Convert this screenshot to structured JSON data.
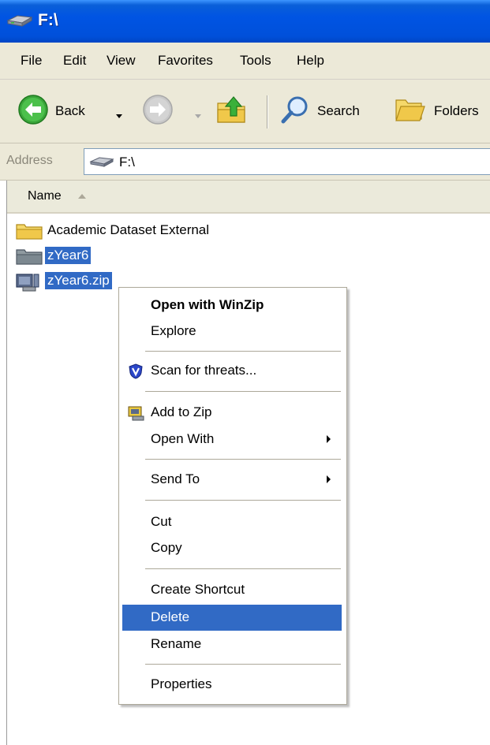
{
  "window": {
    "title": "F:\\"
  },
  "menu": [
    "File",
    "Edit",
    "View",
    "Favorites",
    "Tools",
    "Help"
  ],
  "toolbar": {
    "back_label": "Back",
    "search_label": "Search",
    "folders_label": "Folders"
  },
  "address": {
    "label": "Address",
    "value": "F:\\"
  },
  "columns": {
    "name": "Name"
  },
  "files": [
    {
      "name": "Academic Dataset External",
      "icon": "folder-icon",
      "selected": false
    },
    {
      "name": "zYear6",
      "icon": "folder-icon",
      "selected": true
    },
    {
      "name": "zYear6.zip",
      "icon": "zip-icon",
      "selected": true
    }
  ],
  "context_menu": {
    "items": [
      {
        "label": "Open with WinZip",
        "bold": true
      },
      {
        "label": "Explore"
      },
      {
        "label": "Scan for threats...",
        "icon": "shield-icon"
      },
      {
        "label": "Add to Zip",
        "icon": "winzip-icon"
      },
      {
        "label": "Open With",
        "submenu": true
      },
      {
        "label": "Send To",
        "submenu": true
      },
      {
        "label": "Cut"
      },
      {
        "label": "Copy"
      },
      {
        "label": "Create Shortcut"
      },
      {
        "label": "Delete",
        "highlighted": true
      },
      {
        "label": "Rename"
      },
      {
        "label": "Properties"
      }
    ]
  },
  "colors": {
    "titlebar": "#0054e3",
    "selection": "#316ac5",
    "chrome": "#ece9d8"
  }
}
